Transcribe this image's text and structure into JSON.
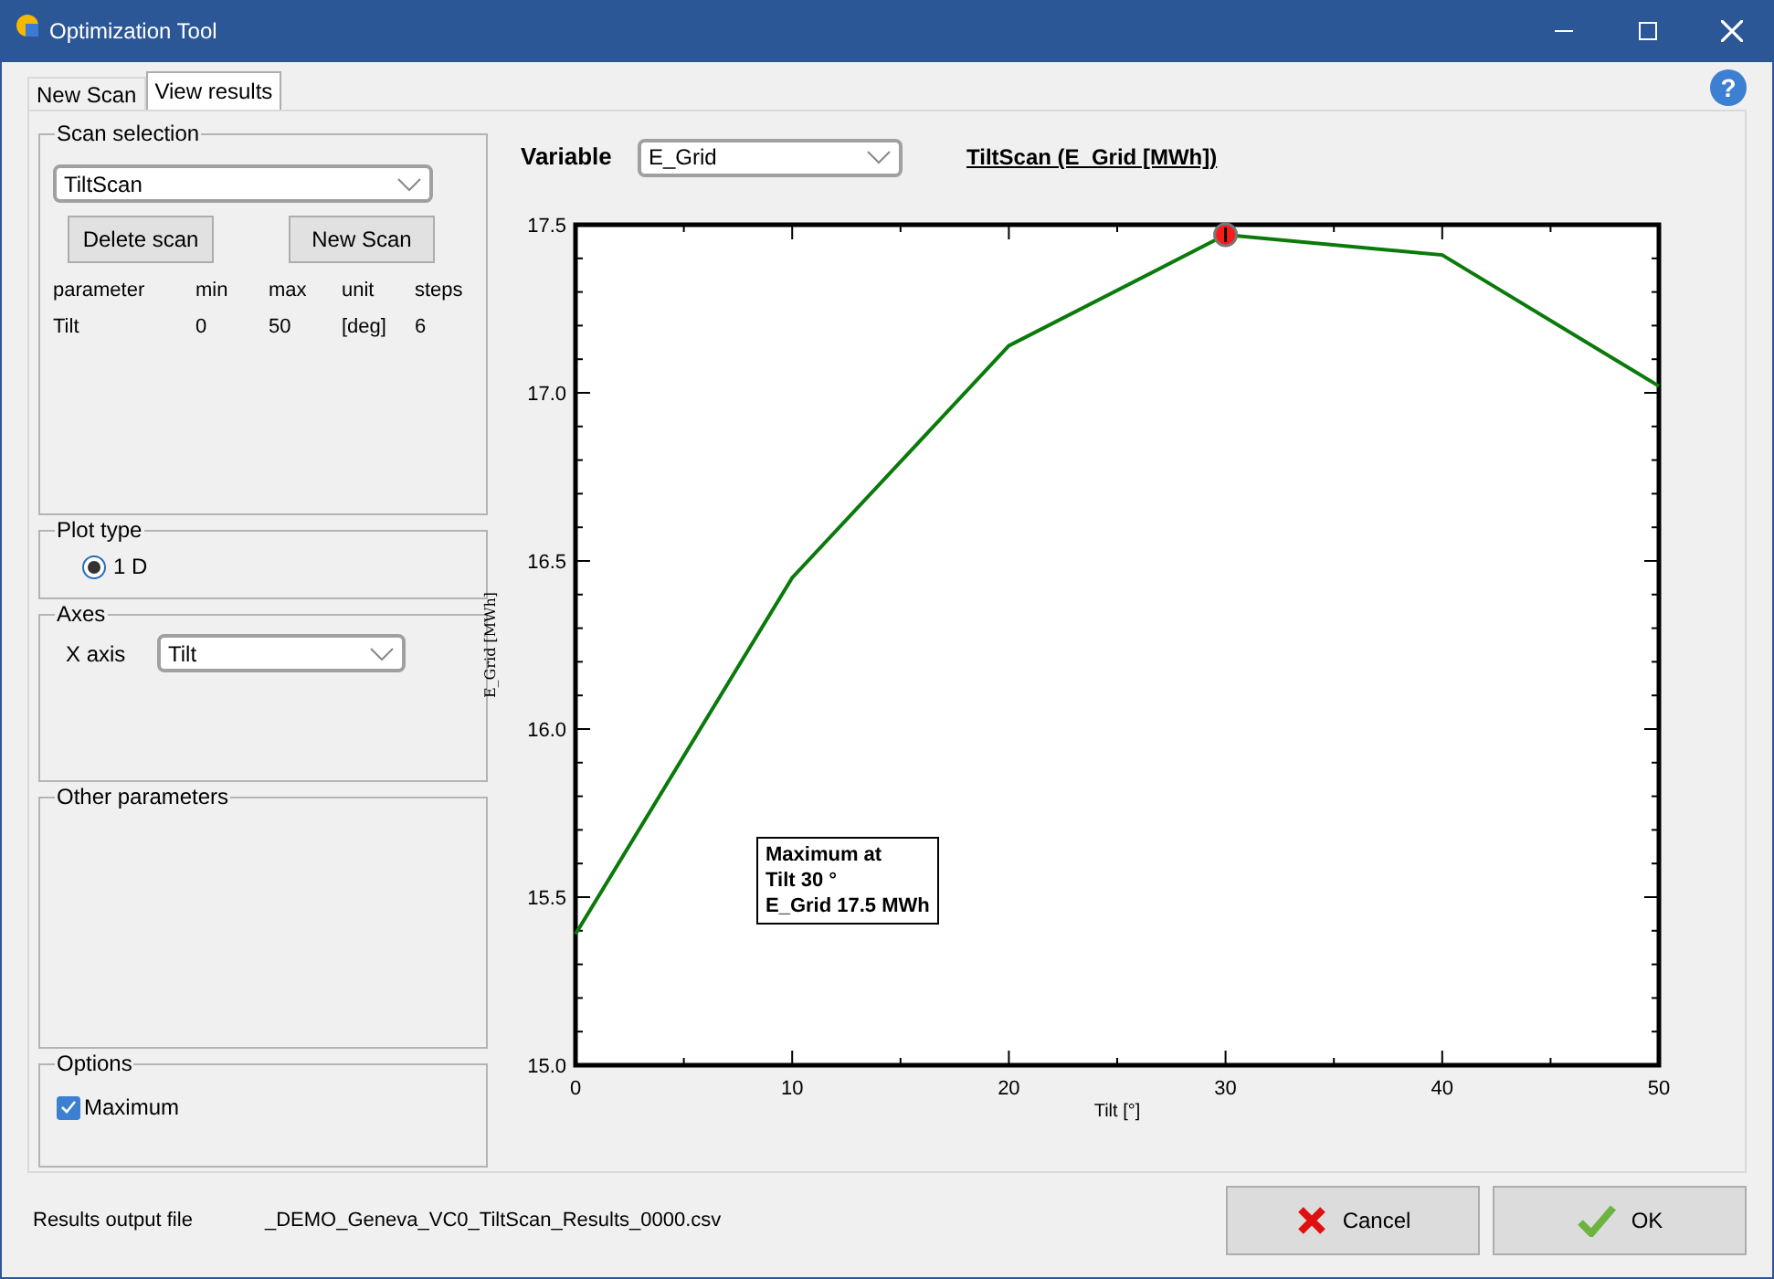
{
  "window": {
    "title": "Optimization Tool"
  },
  "tabs": [
    {
      "label": "New Scan",
      "selected": false
    },
    {
      "label": "View results",
      "selected": true
    }
  ],
  "help_button": {
    "label": "?"
  },
  "scan_selection": {
    "legend": "Scan selection",
    "scan": "TiltScan",
    "buttons": [
      "Delete scan",
      "New Scan"
    ],
    "columns": [
      "parameter",
      "min",
      "max",
      "unit",
      "steps"
    ],
    "rows": [
      [
        "Tilt",
        "0",
        "50",
        "[deg]",
        "6"
      ]
    ]
  },
  "plot_type": {
    "legend": "Plot type",
    "options": [
      {
        "label": "1 D",
        "selected": true
      }
    ]
  },
  "axes": {
    "legend": "Axes",
    "x_axis_label": "X axis",
    "x_axis_value": "Tilt"
  },
  "other_parameters": {
    "legend": "Other parameters"
  },
  "options": {
    "legend": "Options",
    "items": [
      {
        "label": "Maximum",
        "checked": true
      }
    ]
  },
  "variable": {
    "label": "Variable",
    "value": "E_Grid"
  },
  "chart_title": "TiltScan (E_Grid [MWh])",
  "chart": {
    "chart_data": {
      "type": "line",
      "xlabel": "Tilt [°]",
      "ylabel": "E_Grid [MWh]",
      "x": [
        0,
        10,
        20,
        30,
        40,
        50
      ],
      "series": [
        {
          "color": "#0a7a0a",
          "values": [
            15.39,
            16.45,
            17.14,
            17.47,
            17.41,
            17.02
          ]
        }
      ],
      "xlim": [
        0,
        50
      ],
      "ylim": [
        15.0,
        17.5
      ],
      "xticks": [
        0,
        10,
        20,
        30,
        40,
        50
      ],
      "yticks": [
        {
          "value": 15.0,
          "label": "15.0"
        },
        {
          "value": 15.5,
          "label": "15.5"
        },
        {
          "value": 16.0,
          "label": "16.0"
        },
        {
          "value": 16.5,
          "label": "16.5"
        },
        {
          "value": 17.0,
          "label": "17.0"
        },
        {
          "value": 17.5,
          "label": "17.5"
        }
      ]
    },
    "max_box": [
      "Maximum at",
      "Tilt 30 °",
      "E_Grid 17.5 MWh"
    ]
  },
  "footer": {
    "label": "Results output file",
    "file": "_DEMO_Geneva_VC0_TiltScan_Results_0000.csv"
  },
  "buttons": [
    {
      "label": "Cancel",
      "kind": "cancel"
    },
    {
      "label": "OK",
      "kind": "ok"
    }
  ]
}
